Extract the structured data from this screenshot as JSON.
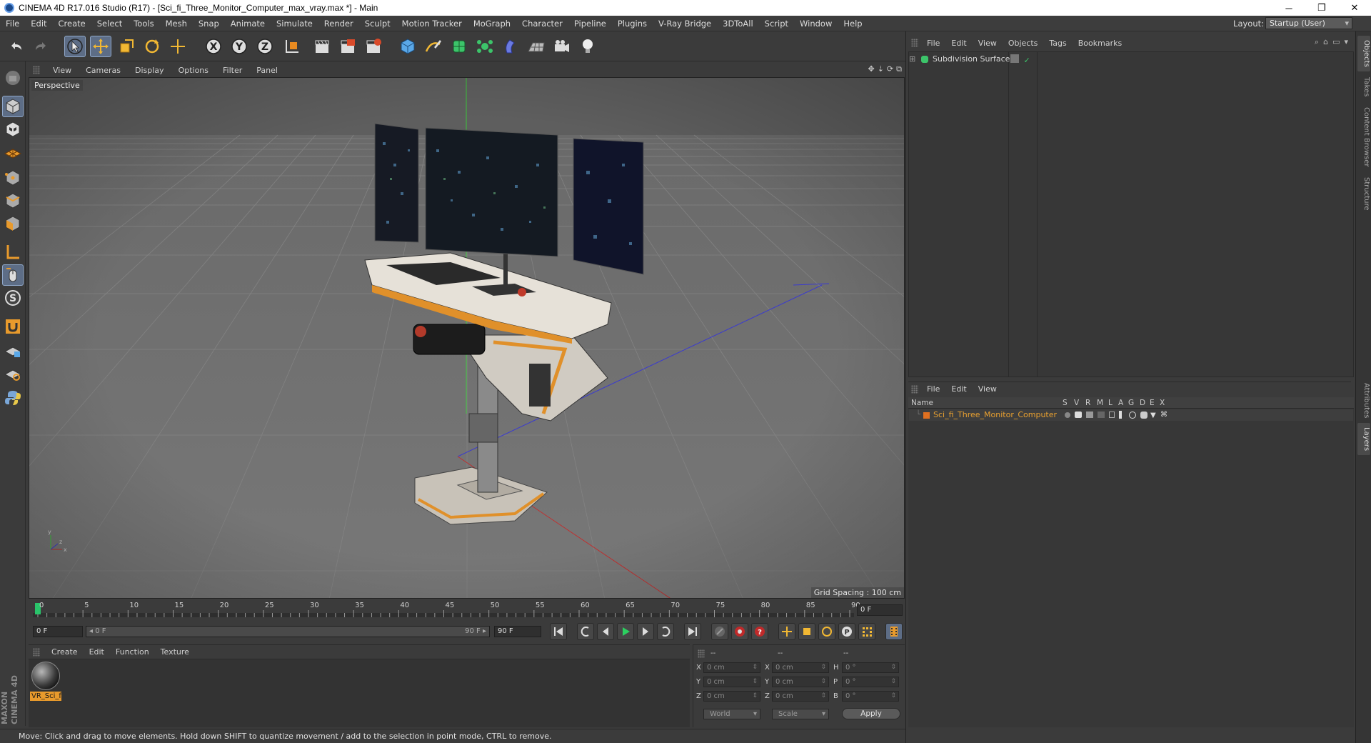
{
  "window": {
    "title": "CINEMA 4D R17.016 Studio (R17) - [Sci_fi_Three_Monitor_Computer_max_vray.max *] - Main",
    "minimize": "─",
    "maximize": "❐",
    "close": "✕"
  },
  "menubar": {
    "items": [
      "File",
      "Edit",
      "Create",
      "Select",
      "Tools",
      "Mesh",
      "Snap",
      "Animate",
      "Simulate",
      "Render",
      "Sculpt",
      "Motion Tracker",
      "MoGraph",
      "Character",
      "Pipeline",
      "Plugins",
      "V-Ray Bridge",
      "3DToAll",
      "Script",
      "Window",
      "Help"
    ],
    "layout_label": "Layout:",
    "layout_value": "Startup (User)"
  },
  "viewport": {
    "menu": [
      "View",
      "Cameras",
      "Display",
      "Options",
      "Filter",
      "Panel"
    ],
    "label": "Perspective",
    "grid_spacing": "Grid Spacing : 100 cm"
  },
  "timeline": {
    "ticks": [
      "0",
      "5",
      "10",
      "15",
      "20",
      "25",
      "30",
      "35",
      "40",
      "45",
      "50",
      "55",
      "60",
      "65",
      "70",
      "75",
      "80",
      "85",
      "90"
    ],
    "current_frame_field": "0 F",
    "start_field": "0 F",
    "range_start": "◂ 0 F",
    "range_end": "90 F ▸",
    "end_field": "90 F"
  },
  "material_manager": {
    "menu": [
      "Create",
      "Edit",
      "Function",
      "Texture"
    ],
    "material_name": "VR_Sci_f"
  },
  "coordinates": {
    "headers": [
      "--",
      "--",
      "--"
    ],
    "rows": [
      {
        "l1": "X",
        "v1": "0 cm",
        "l2": "X",
        "v2": "0 cm",
        "l3": "H",
        "v3": "0 °"
      },
      {
        "l1": "Y",
        "v1": "0 cm",
        "l2": "Y",
        "v2": "0 cm",
        "l3": "P",
        "v3": "0 °"
      },
      {
        "l1": "Z",
        "v1": "0 cm",
        "l2": "Z",
        "v2": "0 cm",
        "l3": "B",
        "v3": "0 °"
      }
    ],
    "space_select": "World",
    "mode_select": "Scale",
    "apply_label": "Apply"
  },
  "object_manager": {
    "menu": [
      "File",
      "Edit",
      "View",
      "Objects",
      "Tags",
      "Bookmarks"
    ],
    "objects": [
      {
        "name": "Subdivision Surface"
      }
    ]
  },
  "layer_manager": {
    "menu": [
      "File",
      "Edit",
      "View"
    ],
    "columns": [
      "Name",
      "S",
      "V",
      "R",
      "M",
      "L",
      "A",
      "G",
      "D",
      "E",
      "X"
    ],
    "layers": [
      {
        "name": "Sci_fi_Three_Monitor_Computer",
        "color": "#e07020"
      }
    ]
  },
  "side_tabs": [
    "Objects",
    "Takes",
    "Content Browser",
    "Structure",
    "Attributes",
    "Layers"
  ],
  "status_bar": "Move: Click and drag to move elements. Hold down SHIFT to quantize movement / add to the selection in point mode, CTRL to remove.",
  "colors": {
    "accent_orange": "#e89a2c",
    "active_tool": "#5d6d86",
    "background": "#3b3b3b"
  }
}
